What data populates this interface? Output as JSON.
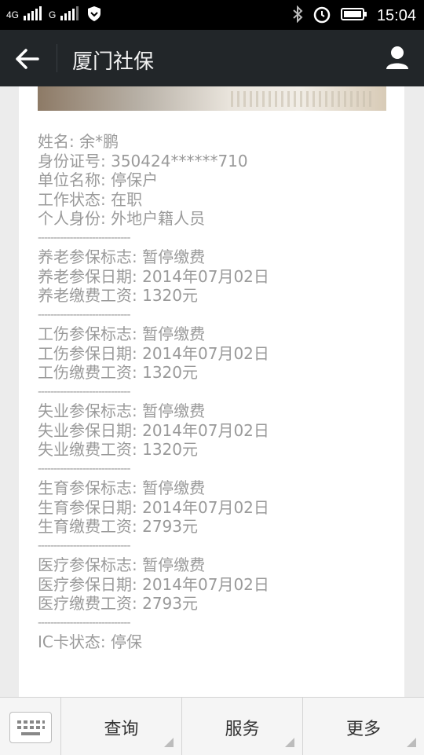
{
  "status_bar": {
    "net1": "4G",
    "net2": "4G",
    "net2b": "G",
    "time": "15:04"
  },
  "header": {
    "title": "厦门社保"
  },
  "info": {
    "lines": [
      "姓名: 余*鹏",
      "身份证号: 350424******710",
      "单位名称: 停保户",
      "工作状态: 在职",
      "个人身份: 外地户籍人员",
      "-----------------------------",
      "养老参保标志:  暂停缴费",
      "养老参保日期: 2014年07月02日",
      "养老缴费工资: 1320元",
      "-----------------------------",
      "工伤参保标志:  暂停缴费",
      "工伤参保日期: 2014年07月02日",
      "工伤缴费工资: 1320元",
      "-----------------------------",
      "失业参保标志:  暂停缴费",
      "失业参保日期: 2014年07月02日",
      "失业缴费工资: 1320元",
      "-----------------------------",
      "生育参保标志:  暂停缴费",
      "生育参保日期: 2014年07月02日",
      "生育缴费工资: 2793元",
      "-----------------------------",
      "医疗参保标志:  暂停缴费",
      "医疗参保日期: 2014年07月02日",
      "医疗缴费工资: 2793元",
      "-----------------------------",
      "IC卡状态: 停保"
    ]
  },
  "nav": {
    "tabs": [
      {
        "label": "查询"
      },
      {
        "label": "服务"
      },
      {
        "label": "更多"
      }
    ]
  }
}
